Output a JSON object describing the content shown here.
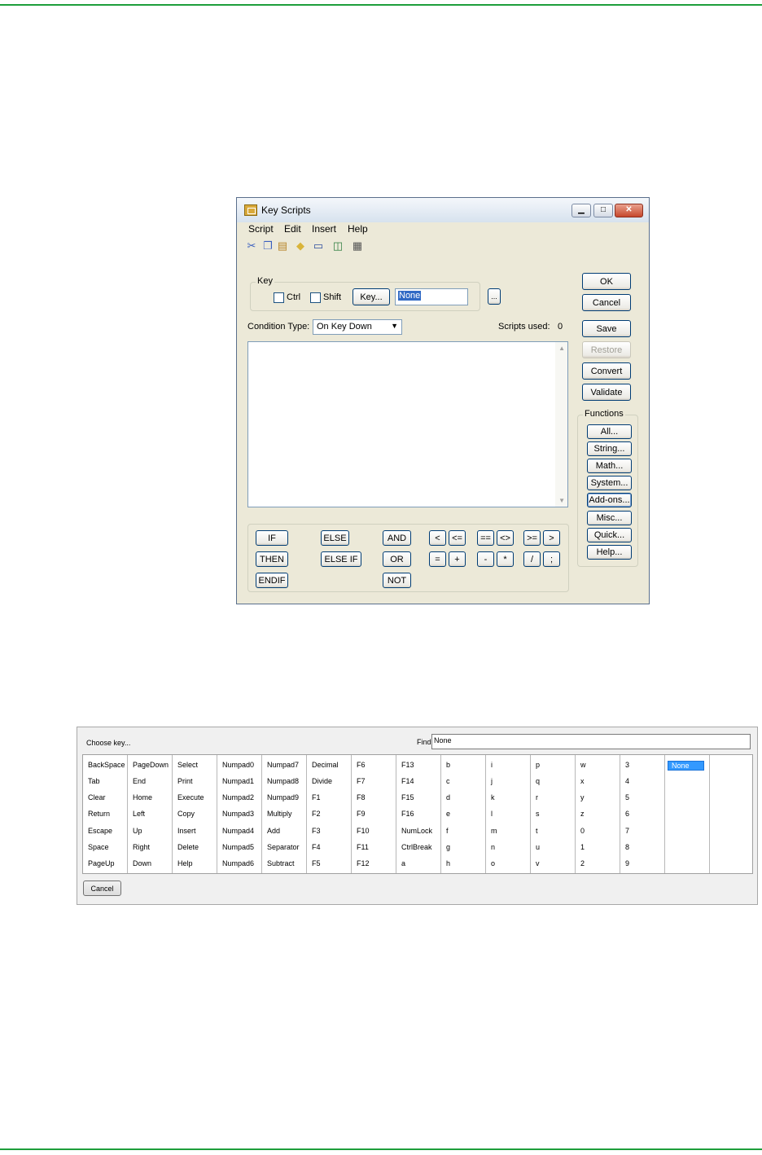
{
  "window": {
    "title": "Key Scripts",
    "menu": [
      "Script",
      "Edit",
      "Insert",
      "Help"
    ],
    "toolbar_icons": [
      "cut-icon",
      "copy-icon",
      "paste-icon",
      "tag-icon",
      "window-icon",
      "new-window-icon",
      "print-icon"
    ],
    "key_group": {
      "legend": "Key",
      "ctrl_label": "Ctrl",
      "shift_label": "Shift",
      "key_button": "Key...",
      "key_value": "None",
      "browse_button": "..."
    },
    "condition": {
      "label": "Condition Type:",
      "value": "On Key Down"
    },
    "scripts_used": {
      "label": "Scripts used:",
      "value": "0"
    },
    "right_buttons": [
      "OK",
      "Cancel",
      "Save",
      "Restore",
      "Convert",
      "Validate"
    ],
    "functions": {
      "legend": "Functions",
      "buttons": [
        "All...",
        "String...",
        "Math...",
        "System...",
        "Add-ons...",
        "Misc...",
        "Quick...",
        "Help..."
      ]
    },
    "keywords": [
      "IF",
      "ELSE",
      "AND",
      "THEN",
      "ELSE IF",
      "OR",
      "ENDIF",
      "NOT"
    ],
    "operators": [
      "<",
      "<=",
      "==",
      "<>",
      ">=",
      ">",
      "=",
      "+",
      "-",
      "*",
      "/",
      ";"
    ]
  },
  "choose_key": {
    "title": "Choose key...",
    "find_label": "Find",
    "find_value": "None",
    "cancel": "Cancel",
    "selected": "None",
    "columns": [
      [
        "BackSpace",
        "Tab",
        "Clear",
        "Return",
        "Escape",
        "Space",
        "PageUp"
      ],
      [
        "PageDown",
        "End",
        "Home",
        "Left",
        "Up",
        "Right",
        "Down"
      ],
      [
        "Select",
        "Print",
        "Execute",
        "Copy",
        "Insert",
        "Delete",
        "Help"
      ],
      [
        "Numpad0",
        "Numpad1",
        "Numpad2",
        "Numpad3",
        "Numpad4",
        "Numpad5",
        "Numpad6"
      ],
      [
        "Numpad7",
        "Numpad8",
        "Numpad9",
        "Multiply",
        "Add",
        "Separator",
        "Subtract"
      ],
      [
        "Decimal",
        "Divide",
        "F1",
        "F2",
        "F3",
        "F4",
        "F5"
      ],
      [
        "F6",
        "F7",
        "F8",
        "F9",
        "F10",
        "F11",
        "F12"
      ],
      [
        "F13",
        "F14",
        "F15",
        "F16",
        "NumLock",
        "CtrlBreak",
        "a"
      ],
      [
        "b",
        "c",
        "d",
        "e",
        "f",
        "g",
        "h"
      ],
      [
        "i",
        "j",
        "k",
        "l",
        "m",
        "n",
        "o"
      ],
      [
        "p",
        "q",
        "r",
        "s",
        "t",
        "u",
        "v"
      ],
      [
        "w",
        "x",
        "y",
        "z",
        "0",
        "1",
        "2"
      ],
      [
        "3",
        "4",
        "5",
        "6",
        "7",
        "8",
        "9"
      ],
      [
        "None"
      ],
      []
    ]
  }
}
